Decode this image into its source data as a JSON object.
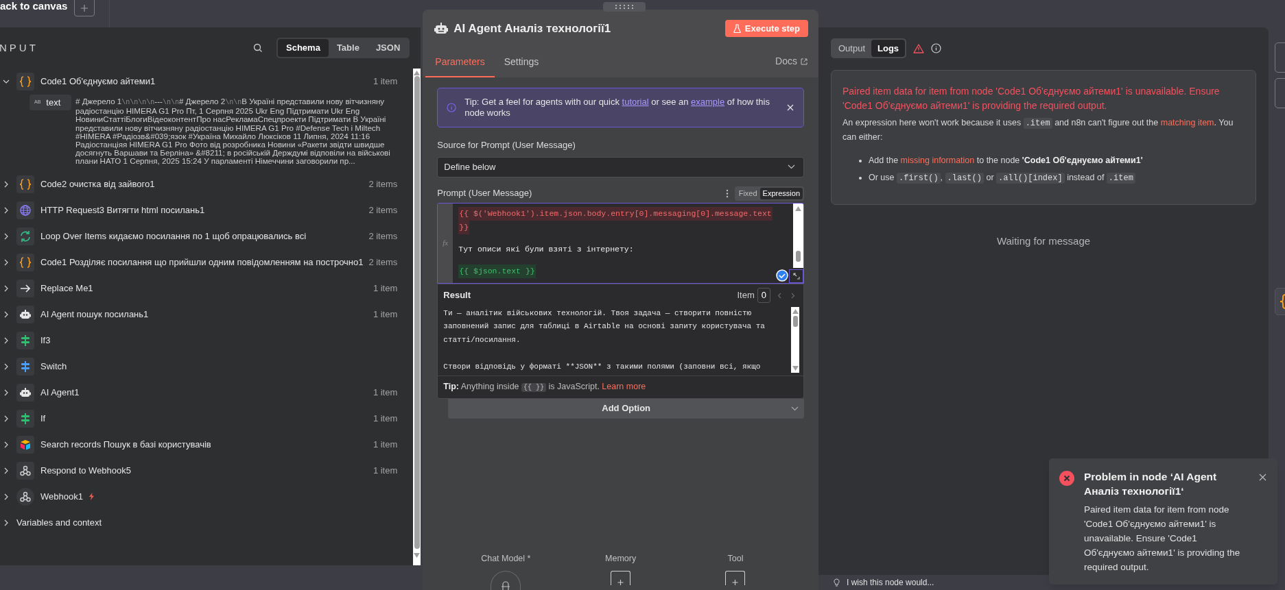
{
  "top_bar": {
    "back_link": "ack to canvas"
  },
  "input_panel": {
    "title": "NPUT",
    "view_tabs": [
      {
        "label": "Schema",
        "selected": true
      },
      {
        "label": "Table",
        "selected": false
      },
      {
        "label": "JSON",
        "selected": false
      }
    ],
    "nodes": [
      {
        "kind": "code",
        "name": "Code1 Об'єднуємо айтеми1",
        "count": "1 item",
        "expanded": true,
        "trigger": false,
        "fields": [
          {
            "type": "AB",
            "name": "text",
            "value": "# Джерело 1\\n\\n\\n\\n---\\n\\n# Джерело 2\\n\\nВ Україні представили нову вітчизняну радіостанцію HIMERA G1 Pro Пт, 1 Серпня 2025 Ukr Eng Підтримати Ukr Eng НовиниСтаттіБлогиВідеоконтентПро насРекламаСпецпроекти Підтримати В Україні представили нову вітчизняну радіостанцію HIMERA G1 Pro #Defense Tech і Miltech #HIMERA #Радіозв&#039;язок #Україна Михайло Люксіков 11 Липня, 2024 11:16 Радіостанціяя HIMERA G1 Pro Фото від розробника Новини «Ракети звідти швидше досягнуть Варшави та Берліна» &#8211; в російській Держдумі відповіли на військові плани НАТО 1 Серпня, 2025 15:24 У парламенті Німеччини заговорили пр..."
          }
        ]
      },
      {
        "kind": "code",
        "name": "Code2 очистка від зайвого1",
        "count": "2 items",
        "expanded": false,
        "trigger": false
      },
      {
        "kind": "http",
        "name": "HTTP Request3 Витягти html посилань1",
        "count": "2 items",
        "expanded": false,
        "trigger": false
      },
      {
        "kind": "loop",
        "name": "Loop Over Items кидаємо посилання по 1 щоб опрацювались всі",
        "count": "2 items",
        "expanded": false,
        "trigger": false
      },
      {
        "kind": "code",
        "name": "Code1 Розділяє посилання що прийшли одним повідомленням на построчно1",
        "count": "2 items",
        "expanded": false,
        "trigger": false
      },
      {
        "kind": "arrow",
        "name": "Replace Me1",
        "count": "1 item",
        "expanded": false,
        "trigger": false
      },
      {
        "kind": "agent",
        "name": "AI Agent пошук посилань1",
        "count": "1 item",
        "expanded": false,
        "trigger": false
      },
      {
        "kind": "if",
        "name": "If3",
        "expanded": false,
        "trigger": false
      },
      {
        "kind": "switch",
        "name": "Switch",
        "expanded": false,
        "trigger": false
      },
      {
        "kind": "agent",
        "name": "AI Agent1",
        "count": "1 item",
        "expanded": false,
        "trigger": false
      },
      {
        "kind": "if",
        "name": "If",
        "count": "1 item",
        "expanded": false,
        "trigger": false
      },
      {
        "kind": "airtable",
        "name": "Search records Пошук в базі користувачів",
        "count": "1 item",
        "expanded": false,
        "trigger": false
      },
      {
        "kind": "webhook",
        "name": "Respond to Webhook5",
        "count": "1 item",
        "expanded": false,
        "trigger": false
      },
      {
        "kind": "webhook",
        "name": "Webhook1",
        "expanded": false,
        "trigger": true
      }
    ],
    "variables": {
      "label": "Variables and context",
      "expanded": false
    }
  },
  "node_panel": {
    "title": "AI Agent Аналіз технології1",
    "execute_button": "Execute step",
    "tabs": [
      {
        "label": "Parameters",
        "selected": true
      },
      {
        "label": "Settings",
        "selected": false
      }
    ],
    "docs_link": "Docs",
    "tip": [
      {
        "kind": "text",
        "text": "Tip: Get a feel for agents with our quick "
      },
      {
        "kind": "link",
        "text": "tutorial"
      },
      {
        "kind": "text",
        "text": " or see an "
      },
      {
        "kind": "link",
        "text": "example"
      },
      {
        "kind": "text",
        "text": " of how this node works"
      }
    ],
    "source": {
      "label": "Source for Prompt (User Message)",
      "value": "Define below"
    },
    "prompt": {
      "label": "Prompt (User Message)",
      "modes": [
        {
          "label": "Fixed",
          "selected": false
        },
        {
          "label": "Expression",
          "selected": true
        }
      ],
      "gutter_label": "fx",
      "segments": [
        {
          "kind": "invalid",
          "lines": [
            "{{ $('Webhook1').item.json.body.entry[0].messaging[0].message.text",
            "}}"
          ]
        },
        {
          "kind": "text",
          "lines": [
            "Тут описи які були взяті з інтернету:"
          ]
        },
        {
          "kind": "valid",
          "lines": [
            "{{ $json.text }}"
          ]
        }
      ]
    },
    "result": {
      "label": "Result",
      "item_label": "Item",
      "item_value": "0",
      "paragraphs": [
        "Ти — аналітик військових технологій. Твоя задача — створити повністю заповнений запис для таблиці в Airtable на основі запиту користувача та статті/посилання.",
        "Створи відповідь у форматі **JSON** з такими полями (заповни всі, якщо"
      ],
      "tip": [
        {
          "kind": "bold",
          "text": "Tip:"
        },
        {
          "kind": "text",
          "text": " Anything inside "
        },
        {
          "kind": "code",
          "text": "{{ }}"
        },
        {
          "kind": "text",
          "text": " is JavaScript. "
        },
        {
          "kind": "link",
          "text": "Learn more"
        }
      ]
    },
    "add_option": "Add Option",
    "slots": [
      {
        "kind": "model",
        "label": "Chat Model *"
      },
      {
        "kind": "add",
        "label": "Memory"
      },
      {
        "kind": "add",
        "label": "Tool"
      }
    ]
  },
  "output_panel": {
    "tabs": [
      {
        "label": "Output",
        "selected": false
      },
      {
        "label": "Logs",
        "selected": true
      }
    ],
    "error": {
      "title": "Paired item data for item from node 'Code1 Об'єднуємо айтеми1' is unavailable. Ensure 'Code1 Об'єднуємо айтеми1' is providing the required output.",
      "description": [
        {
          "kind": "text",
          "text": "An expression here won't work because it uses "
        },
        {
          "kind": "code",
          "text": ".item"
        },
        {
          "kind": "text",
          "text": " and n8n can't figure out the "
        },
        {
          "kind": "link",
          "text": "matching item"
        },
        {
          "kind": "text",
          "text": ". You can either:"
        }
      ],
      "bullets": [
        [
          {
            "kind": "text",
            "text": "Add the "
          },
          {
            "kind": "link",
            "text": "missing information"
          },
          {
            "kind": "text",
            "text": " to the node "
          },
          {
            "kind": "bold",
            "text": "'Code1 Об'єднуємо айтеми1'"
          }
        ],
        [
          {
            "kind": "text",
            "text": "Or use "
          },
          {
            "kind": "code",
            "text": ".first()"
          },
          {
            "kind": "text",
            "text": ", "
          },
          {
            "kind": "code",
            "text": ".last()"
          },
          {
            "kind": "text",
            "text": " or "
          },
          {
            "kind": "code",
            "text": ".all()[index]"
          },
          {
            "kind": "text",
            "text": " instead of "
          },
          {
            "kind": "code",
            "text": ".item"
          }
        ]
      ]
    },
    "waiting": "Waiting for message",
    "feedback": "I wish this node would..."
  },
  "toast": {
    "title": "Problem in node ‘AI Agent Аналіз технології1‘",
    "message": "Paired item data for item from node 'Code1 Об'єднуємо айтеми1' is unavailable. Ensure 'Code1 Об'єднуємо айтеми1' is providing the required output."
  }
}
